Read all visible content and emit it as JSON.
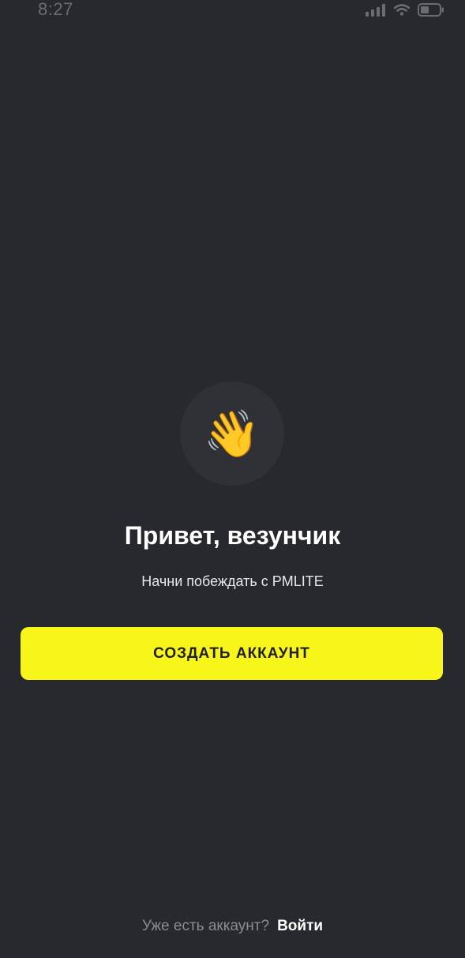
{
  "status_bar": {
    "time": "8:27",
    "icons": [
      "signal-icon",
      "wifi-icon",
      "battery-icon"
    ]
  },
  "greeting": {
    "icon": "waving-hand-icon",
    "icon_glyph": "👋",
    "title": "Привет, везунчик",
    "subtitle": "Начни побеждать с PMLITE"
  },
  "cta": {
    "label": "СОЗДАТЬ АККАУНТ"
  },
  "footer": {
    "prompt": "Уже есть аккаунт?",
    "login_label": "Войти"
  },
  "colors": {
    "background": "#27292e",
    "accent": "#f7f51a",
    "button_text": "#1f2024"
  }
}
